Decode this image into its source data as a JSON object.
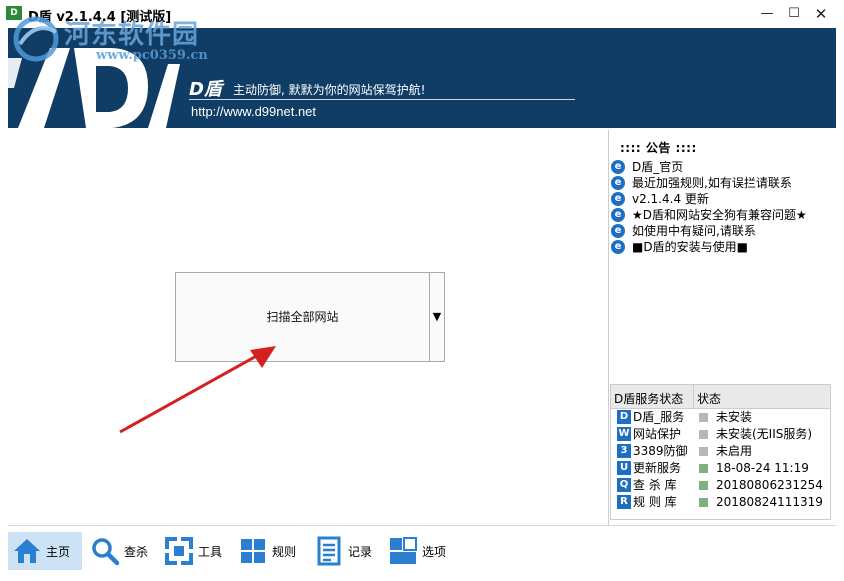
{
  "window": {
    "title": "D盾 v2.1.4.4 [测试版]",
    "app_icon_text": "D",
    "min_glyph": "—",
    "max_glyph": "☐",
    "close_glyph": "✕"
  },
  "watermark": {
    "text": "河东软件园",
    "url": "www.pc0359.cn"
  },
  "banner": {
    "brand": "D盾",
    "slogan": "主动防御, 默默为你的网站保驾护航!",
    "url": "http://www.d99net.net"
  },
  "scan": {
    "label": "扫描全部网站",
    "dropdown_glyph": "▼"
  },
  "notice": {
    "title": "::::  公告  ::::",
    "items": [
      "D盾_官页",
      "最近加强规则,如有误拦请联系",
      "v2.1.4.4 更新",
      "★D盾和网站安全狗有兼容问题★",
      "如使用中有疑问,请联系",
      "■D盾的安装与使用■"
    ]
  },
  "status": {
    "header_service": "D盾服务状态",
    "header_status": "状态",
    "rows": [
      {
        "icon": "D",
        "name": "D盾_服务",
        "value": "未安装",
        "ok": false
      },
      {
        "icon": "W",
        "name": "网站保护",
        "value": "未安装(无IIS服务)",
        "ok": false
      },
      {
        "icon": "3",
        "name": "3389防御",
        "value": "未启用",
        "ok": false
      },
      {
        "icon": "U",
        "name": "更新服务",
        "value": "18-08-24 11:19",
        "ok": true
      },
      {
        "icon": "Q",
        "name": "查 杀 库",
        "value": "20180806231254",
        "ok": true
      },
      {
        "icon": "R",
        "name": "规 则 库",
        "value": "20180824111319",
        "ok": true
      }
    ]
  },
  "toolbar": {
    "home": "主页",
    "scan": "查杀",
    "tools": "工具",
    "rules": "规则",
    "logs": "记录",
    "options": "选项"
  },
  "colors": {
    "banner_bg": "#0f3d66",
    "accent_blue": "#1d6fc4",
    "active_tab": "#cde3f5",
    "arrow_red": "#d42020"
  }
}
